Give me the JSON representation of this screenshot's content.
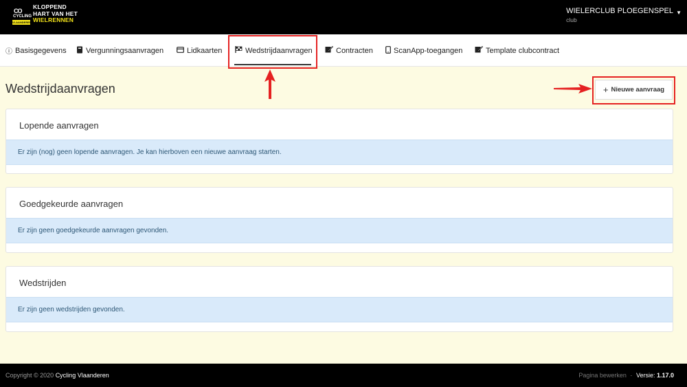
{
  "header": {
    "logo_lines": [
      "KLOPPEND",
      "HART VAN HET",
      "WIELRENNEN"
    ],
    "logo_badge": {
      "top": "CO",
      "middle": "CYCLING",
      "bottom": "VLAANDEREN"
    },
    "club_name": "WIELERCLUB PLOEGENSPEL",
    "club_sub": "club"
  },
  "nav": {
    "items": [
      {
        "label": "Basisgegevens",
        "icon": "info-circle-icon"
      },
      {
        "label": "Vergunningsaanvragen",
        "icon": "book-icon"
      },
      {
        "label": "Lidkaarten",
        "icon": "card-icon"
      },
      {
        "label": "Wedstrijdaanvragen",
        "icon": "checkered-flag-icon"
      },
      {
        "label": "Contracten",
        "icon": "sign-icon"
      },
      {
        "label": "ScanApp-toegangen",
        "icon": "mobile-icon"
      },
      {
        "label": "Template clubcontract",
        "icon": "sign-icon"
      }
    ],
    "active": "Wedstrijdaanvragen"
  },
  "page": {
    "title": "Wedstrijdaanvragen",
    "new_button": "Nieuwe aanvraag",
    "new_button_icon": "plus-icon"
  },
  "panels": [
    {
      "title": "Lopende aanvragen",
      "message": "Er zijn (nog) geen lopende aanvragen. Je kan hierboven een nieuwe aanvraag starten."
    },
    {
      "title": "Goedgekeurde aanvragen",
      "message": "Er zijn geen goedgekeurde aanvragen gevonden."
    },
    {
      "title": "Wedstrijden",
      "message": "Er zijn geen wedstrijden gevonden."
    }
  ],
  "footer": {
    "copyright": "Copyright © 2020",
    "org": "Cycling Vlaanderen",
    "edit_link": "Pagina bewerken",
    "separator": "·",
    "version_label": "Versie:",
    "version": "1.17.0"
  },
  "colors": {
    "topbar": "#000000",
    "brand_yellow": "#f7e61b",
    "content_bg": "#fdfbe2",
    "alert_bg": "#d9eafa",
    "annotation_red": "#e52121"
  }
}
